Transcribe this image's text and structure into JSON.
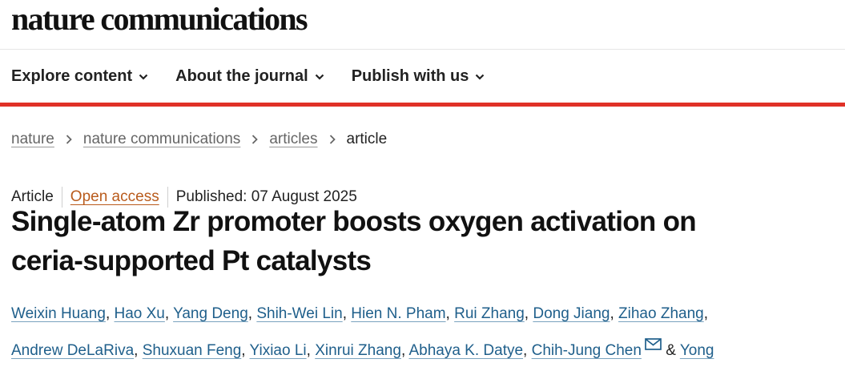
{
  "site": {
    "logo_text": "nature communications"
  },
  "nav": {
    "items": [
      {
        "label": "Explore content",
        "icon": "chevron-down-icon"
      },
      {
        "label": "About the journal",
        "icon": "chevron-down-icon"
      },
      {
        "label": "Publish with us",
        "icon": "chevron-down-icon"
      }
    ]
  },
  "breadcrumb": {
    "items": [
      "nature",
      "nature communications",
      "articles"
    ],
    "current": "article"
  },
  "article": {
    "type": "Article",
    "access": "Open access",
    "published": "Published: 07 August 2025",
    "title_line1": "Single-atom Zr promoter boosts oxygen activation on",
    "title_line2": "ceria-supported Pt catalysts",
    "authors": [
      "Weixin Huang",
      "Hao Xu",
      "Yang Deng",
      "Shih-Wei Lin",
      "Hien N. Pham",
      "Rui Zhang",
      "Dong Jiang",
      "Zihao Zhang",
      "Andrew DeLaRiva",
      "Shuxuan Feng",
      "Yixiao Li",
      "Xinrui Zhang",
      "Abhaya K. Datye",
      "Chih-Jung Chen",
      "Yong"
    ],
    "author_separator": ",",
    "final_separator": "&",
    "corresponding_icon": "mail-icon"
  },
  "colors": {
    "brand_red": "#e03127",
    "link_blue": "#1f5f8b",
    "open_access_orange": "#b95b1c"
  }
}
